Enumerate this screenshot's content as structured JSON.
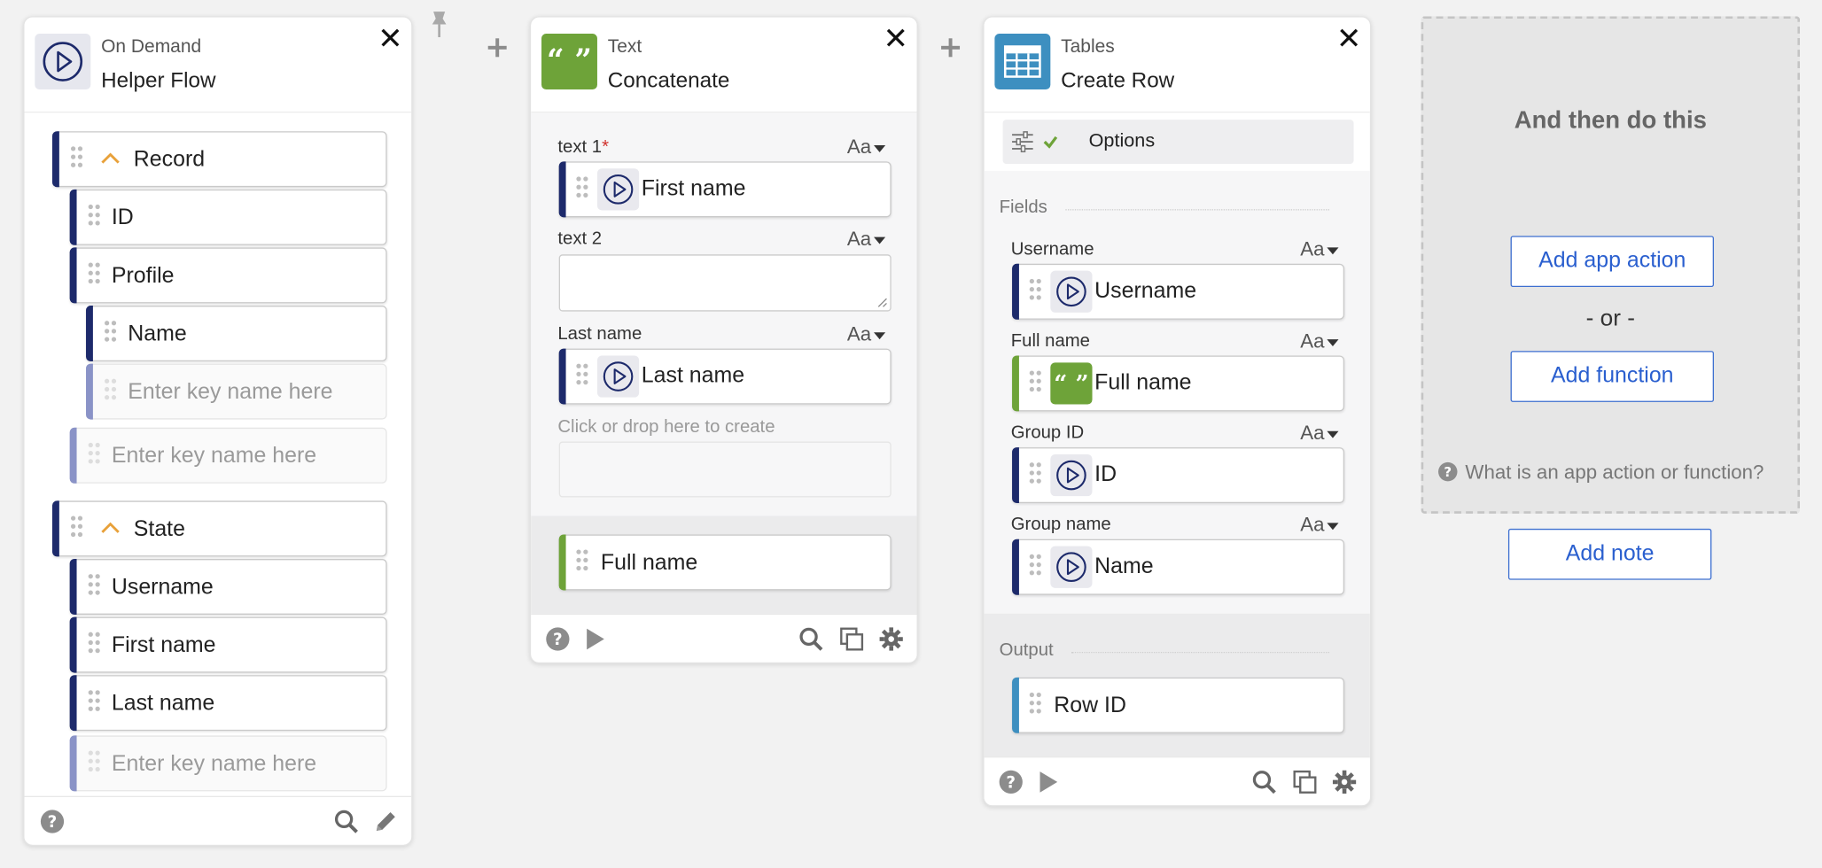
{
  "flow_card": {
    "subtitle": "On Demand",
    "title": "Helper Flow",
    "icon": "play-circle-icon",
    "tree": {
      "record": "Record",
      "id": "ID",
      "profile": "Profile",
      "name": "Name",
      "placeholder_inner": "Enter key name here",
      "placeholder_outer": "Enter key name here",
      "state": "State",
      "username": "Username",
      "first_name": "First name",
      "last_name": "Last name",
      "placeholder_state": "Enter key name here"
    }
  },
  "text_card": {
    "subtitle": "Text",
    "title": "Concatenate",
    "icon": "quote-icon",
    "fields": [
      {
        "label": "text 1",
        "required_mark": "*",
        "type": "Aa",
        "value": "First name"
      },
      {
        "label": "text 2",
        "type": "Aa",
        "value": ""
      },
      {
        "label": "Last name",
        "type": "Aa",
        "value": "Last name"
      }
    ],
    "drop_hint": "Click or drop here to create",
    "output": "Full name"
  },
  "tables_card": {
    "subtitle": "Tables",
    "title": "Create Row",
    "icon": "table-icon",
    "options_label": "Options",
    "fields_section": "Fields",
    "fields": [
      {
        "label": "Username",
        "type": "Aa",
        "value": "Username"
      },
      {
        "label": "Full name",
        "type": "Aa",
        "value": "Full name"
      },
      {
        "label": "Group ID",
        "type": "Aa",
        "value": "ID"
      },
      {
        "label": "Group name",
        "type": "Aa",
        "value": "Name"
      }
    ],
    "output_section": "Output",
    "output": "Row ID"
  },
  "next_step": {
    "heading": "And then do this",
    "add_app_action": "Add app action",
    "or": "- or -",
    "add_function": "Add function",
    "help": "What is an app action or function?",
    "add_note": "Add note"
  },
  "colors": {
    "navy": "#1d2a6b",
    "green": "#6ea339",
    "blue": "#3d8fc0",
    "link": "#2a5fcf"
  }
}
